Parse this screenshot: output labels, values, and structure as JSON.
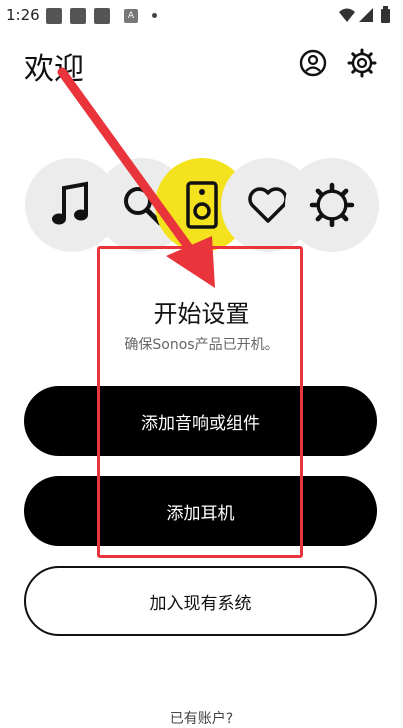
{
  "status_bar": {
    "time": "1:26",
    "notif_letter": "A"
  },
  "header": {
    "title": "欢迎",
    "account_icon": "account-icon",
    "settings_icon": "gear-icon"
  },
  "tabs": [
    {
      "icon": "music-note-icon"
    },
    {
      "icon": "search-icon"
    },
    {
      "icon": "speaker-icon",
      "active": true
    },
    {
      "icon": "heart-icon"
    },
    {
      "icon": "gear-icon"
    }
  ],
  "setup": {
    "title": "开始设置",
    "subtitle": "确保Sonos产品已开机。"
  },
  "buttons": {
    "add_speaker": "添加音响或组件",
    "add_headphones": "添加耳机",
    "join_system": "加入现有系统"
  },
  "bottom_link": "已有账户?",
  "colors": {
    "accent_yellow": "#f5e21f",
    "annotation_red": "#e8343a"
  }
}
